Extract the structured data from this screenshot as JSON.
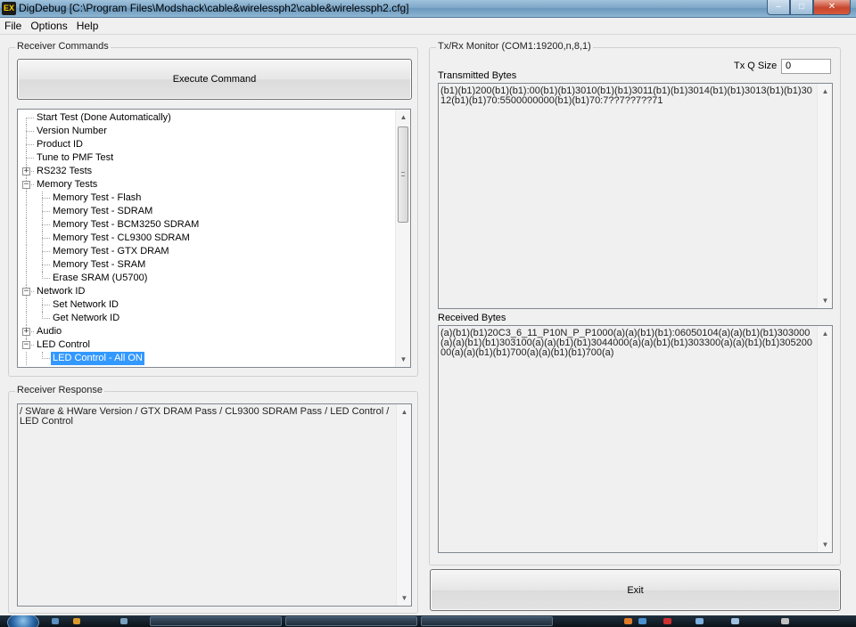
{
  "window": {
    "title": "DigDebug [C:\\Program Files\\Modshack\\cable&wirelessph2\\cable&wirelessph2.cfg]",
    "app_icon_text": "EX",
    "controls": {
      "minimize": "–",
      "maximize": "□",
      "close": "✕"
    }
  },
  "menu": [
    "File",
    "Options",
    "Help"
  ],
  "receiver_commands": {
    "legend": "Receiver Commands",
    "execute_label": "Execute Command",
    "tree": [
      {
        "label": "Start Test (Done Automatically)",
        "level": 0
      },
      {
        "label": "Version Number",
        "level": 0
      },
      {
        "label": "Product ID",
        "level": 0
      },
      {
        "label": "Tune to PMF Test",
        "level": 0
      },
      {
        "label": "RS232 Tests",
        "level": 0,
        "expander": "+"
      },
      {
        "label": "Memory Tests",
        "level": 0,
        "expander": "−"
      },
      {
        "label": "Memory Test - Flash",
        "level": 1
      },
      {
        "label": "Memory Test - SDRAM",
        "level": 1
      },
      {
        "label": "Memory Test - BCM3250 SDRAM",
        "level": 1
      },
      {
        "label": "Memory Test - CL9300 SDRAM",
        "level": 1
      },
      {
        "label": "Memory Test - GTX DRAM",
        "level": 1
      },
      {
        "label": "Memory Test - SRAM",
        "level": 1
      },
      {
        "label": "Erase SRAM (U5700)",
        "level": 1
      },
      {
        "label": "Network ID",
        "level": 0,
        "expander": "−"
      },
      {
        "label": "Set Network ID",
        "level": 1
      },
      {
        "label": "Get Network ID",
        "level": 1
      },
      {
        "label": "Audio",
        "level": 0,
        "expander": "+"
      },
      {
        "label": "LED Control",
        "level": 0,
        "expander": "−"
      },
      {
        "label": "LED Control - All ON",
        "level": 1,
        "selected": true
      }
    ]
  },
  "receiver_response": {
    "legend": "Receiver Response",
    "text": "/ SWare & HWare Version / GTX DRAM Pass / CL9300 SDRAM Pass / LED Control / LED Control"
  },
  "monitor": {
    "legend": "Tx/Rx Monitor (COM1:19200,n,8,1)",
    "txq_label": "Tx Q Size",
    "txq_value": "0",
    "transmitted_label": "Transmitted Bytes",
    "transmitted_text": "(b1)(b1)200(b1)(b1):00(b1)(b1)3010(b1)(b1)3011(b1)(b1)3014(b1)(b1)3013(b1)(b1)3012(b1)(b1)70:5500000000(b1)(b1)70:7??7??7??71",
    "received_label": "Received Bytes",
    "received_text": "(a)(b1)(b1)20C3_6_11_P10N_P_P1000(a)(a)(b1)(b1):06050104(a)(a)(b1)(b1)303000(a)(a)(b1)(b1)303100(a)(a)(b1)(b1)3044000(a)(a)(b1)(b1)303300(a)(a)(b1)(b1)30520000(a)(a)(b1)(b1)700(a)(a)(b1)(b1)700(a)"
  },
  "exit_label": "Exit",
  "scroll_arrows": {
    "up": "▲",
    "down": "▼"
  }
}
